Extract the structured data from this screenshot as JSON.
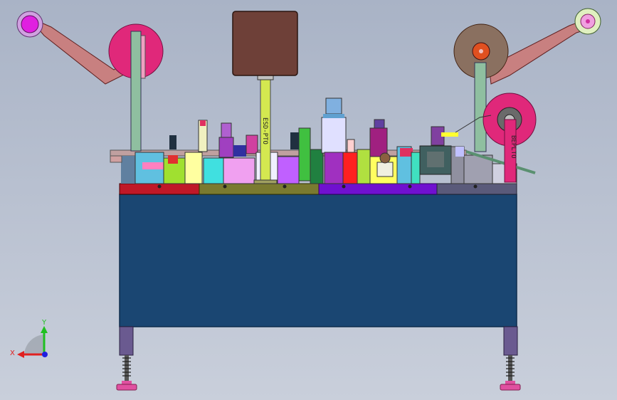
{
  "view": {
    "background_top": "#a9b3c6",
    "background_bottom": "#c9cfdb"
  },
  "colors": {
    "cabinet": "#1a4672",
    "cabinet_edge": "#0d2c4d",
    "arm": "#c88080",
    "reel_pink": "#e0287a",
    "reel_brown": "#8a7060",
    "spindle_magenta": "#e020e0",
    "column_green": "#8fbfa0",
    "box_brown": "#6e4038",
    "rod_yellow": "#d4e850",
    "leg": "#6a5a90",
    "foot": "#e050a0",
    "base_red": "#c01828",
    "base_olive": "#7a7a30",
    "base_purple": "#7010d0",
    "base_slate": "#5a5a7a"
  },
  "vertical_labels": {
    "rod_label": "ESD-PTO",
    "right_column_label": "BEPLTO"
  },
  "triad": {
    "x_label": "X",
    "y_label": "Y",
    "x_color": "#e02020",
    "y_color": "#20c020",
    "z_color": "#2020e0"
  }
}
